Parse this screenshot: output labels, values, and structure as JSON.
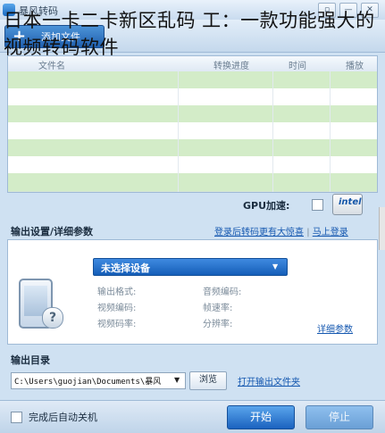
{
  "window": {
    "title": "暴风转码",
    "controls": [
      "▫",
      "—",
      "✕"
    ]
  },
  "overlay_title": "日本一卡二卡新区乱码 工：一款功能强大的视频转码软件",
  "toolbar": {
    "add_file_label": "添加文件"
  },
  "grid": {
    "columns": [
      "文件名",
      "转换进度",
      "时间",
      "播放"
    ],
    "row_colors": [
      "green",
      "white",
      "green",
      "white",
      "green",
      "white",
      "green"
    ]
  },
  "gpu": {
    "label": "GPU加速:",
    "checked": false,
    "badge": "intel"
  },
  "output_settings": {
    "title": "输出设置/详细参数",
    "login_hint": "登录后转码更有",
    "login_link": "大惊喜",
    "login_now": "马上登录",
    "device_select": "未选择设备",
    "fields_left": [
      "输出格式:",
      "视频编码:",
      "视频码率:"
    ],
    "fields_right": [
      "音频编码:",
      "帧速率:",
      "分辨率:"
    ],
    "detail_link": "详细参数"
  },
  "output_dir": {
    "title": "输出目录",
    "path": "C:\\Users\\guojian\\Documents\\暴风",
    "browse_label": "浏览",
    "open_folder_label": "打开输出文件夹"
  },
  "bottom": {
    "shutdown_label": "完成后自动关机",
    "shutdown_checked": false,
    "start_label": "开始",
    "stop_label": "停止"
  },
  "colors": {
    "accent": "#1f5fae",
    "row_green": "#d3ecc8",
    "link": "#1558b0"
  }
}
